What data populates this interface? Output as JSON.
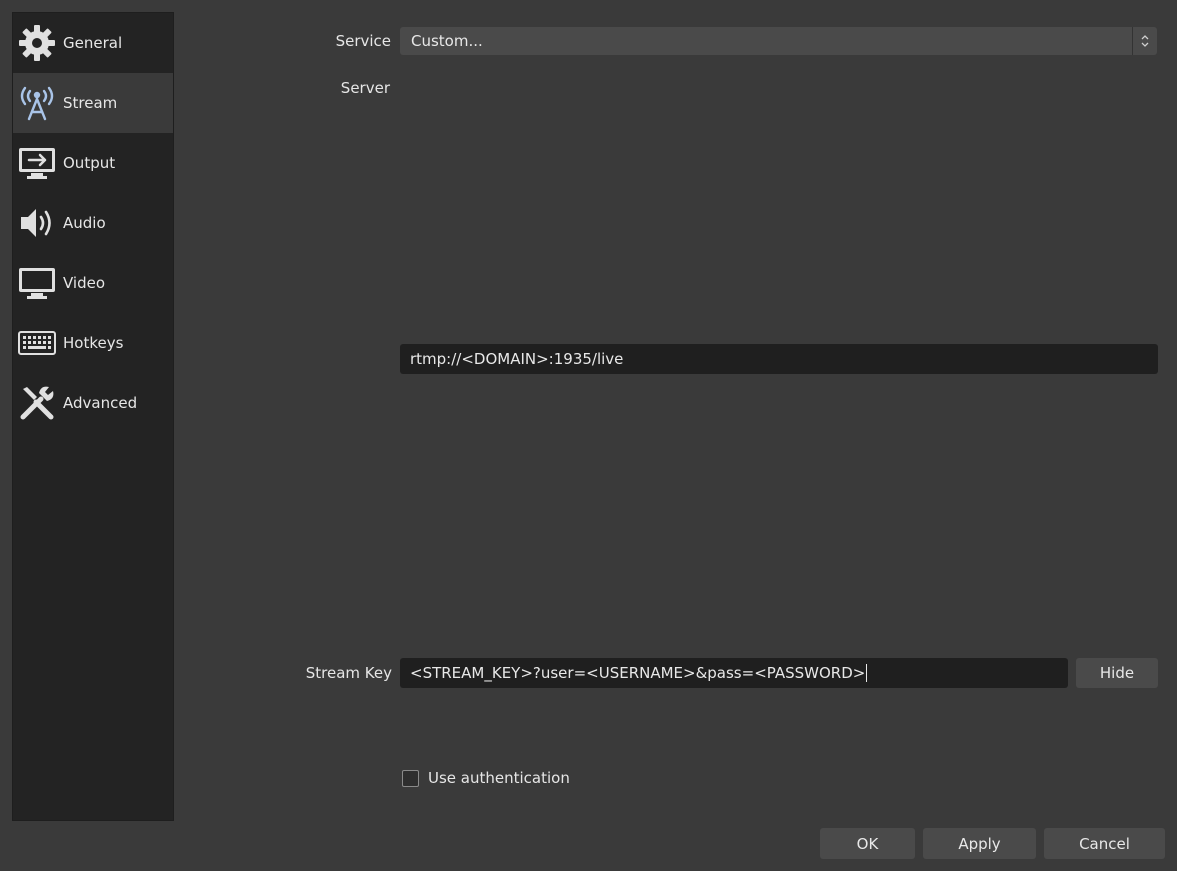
{
  "sidebar": {
    "items": [
      {
        "label": "General",
        "icon": "gear-icon"
      },
      {
        "label": "Stream",
        "icon": "antenna-icon",
        "active": true
      },
      {
        "label": "Output",
        "icon": "output-icon"
      },
      {
        "label": "Audio",
        "icon": "speaker-icon"
      },
      {
        "label": "Video",
        "icon": "monitor-icon"
      },
      {
        "label": "Hotkeys",
        "icon": "keyboard-icon"
      },
      {
        "label": "Advanced",
        "icon": "tools-icon"
      }
    ]
  },
  "form": {
    "service_label": "Service",
    "service_value": "Custom...",
    "server_label": "Server",
    "server_value": "rtmp://<DOMAIN>:1935/live",
    "stream_key_label": "Stream Key",
    "stream_key_value": "<STREAM_KEY>?user=<USERNAME>&pass=<PASSWORD>",
    "hide_label": "Hide",
    "auth_label": "Use authentication",
    "auth_checked": false
  },
  "footer": {
    "ok_label": "OK",
    "apply_label": "Apply",
    "cancel_label": "Cancel"
  },
  "colors": {
    "background": "#3a3a3a",
    "sidebar": "#232323",
    "input": "#1f1f1f",
    "button": "#4a4a4a",
    "accent_icon": "#a9c4e8"
  }
}
